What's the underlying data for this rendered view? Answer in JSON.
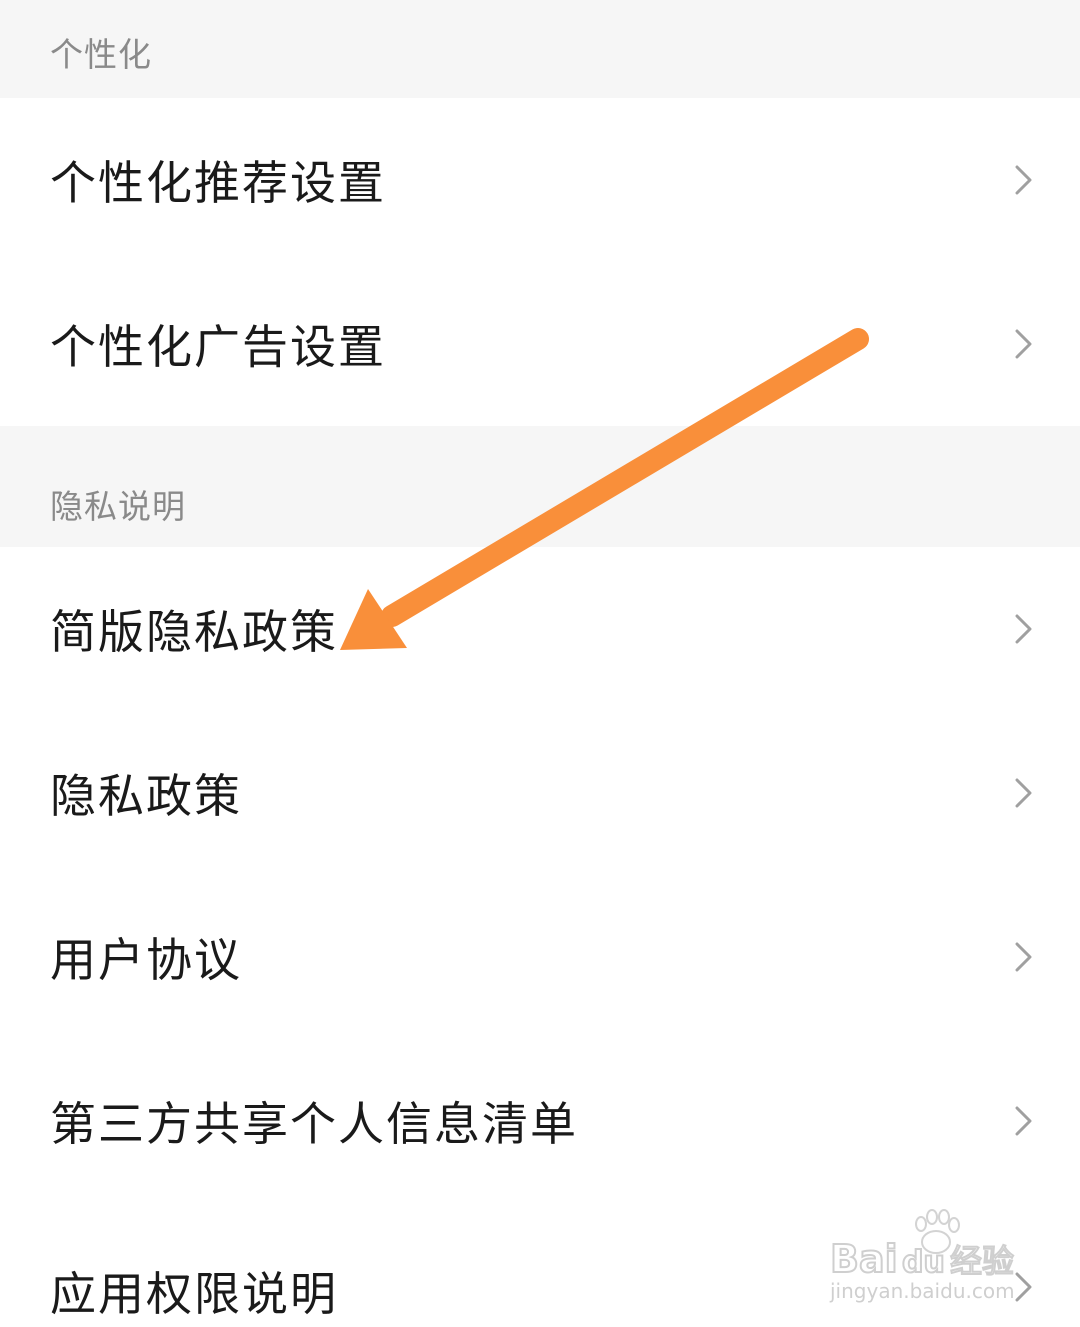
{
  "sections": [
    {
      "header": "个性化",
      "items": [
        {
          "label": "个性化推荐设置",
          "icon": "chevron-right-icon"
        },
        {
          "label": "个性化广告设置",
          "icon": "chevron-right-icon"
        }
      ]
    },
    {
      "header": "隐私说明",
      "items": [
        {
          "label": "简版隐私政策",
          "icon": "chevron-right-icon"
        },
        {
          "label": "隐私政策",
          "icon": "chevron-right-icon"
        },
        {
          "label": "用户协议",
          "icon": "chevron-right-icon"
        },
        {
          "label": "第三方共享个人信息清单",
          "icon": "chevron-right-icon"
        },
        {
          "label": "应用权限说明",
          "icon": "chevron-right-icon"
        }
      ]
    }
  ],
  "annotation": {
    "type": "arrow",
    "color": "#f98f3a",
    "points_to": "简版隐私政策"
  },
  "watermark": {
    "brand": "Baidu经验",
    "url": "jingyan.baidu.com"
  },
  "colors": {
    "section_bg": "#f6f6f6",
    "row_bg": "#ffffff",
    "header_text": "#8a8a8a",
    "item_text": "#1a1a1a",
    "chevron": "#a0a0a0"
  }
}
